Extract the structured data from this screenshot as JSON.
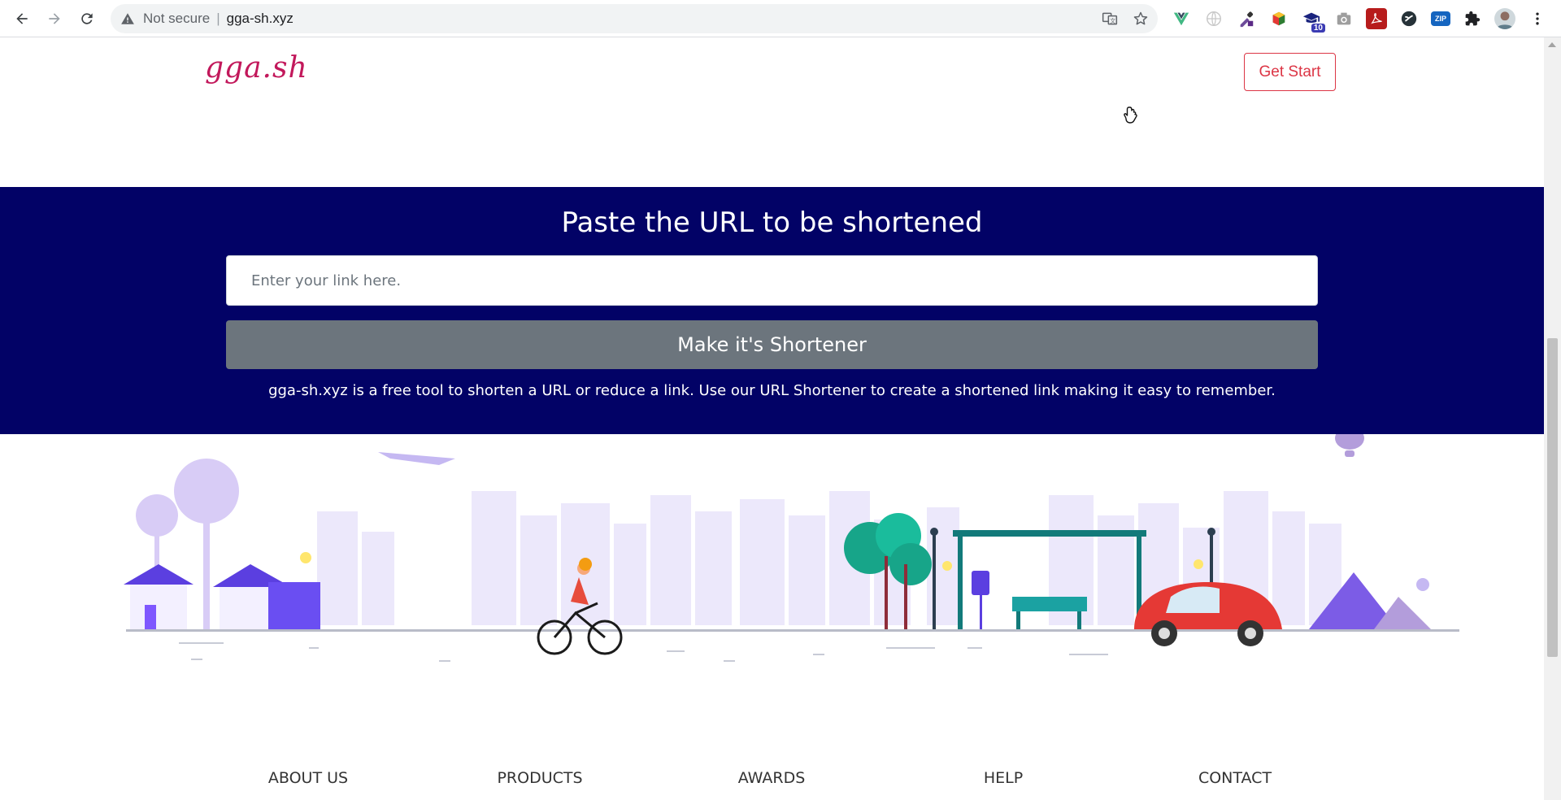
{
  "browser": {
    "security_label": "Not secure",
    "url": "gga-sh.xyz",
    "extensions": [
      {
        "name": "vue-devtools-icon"
      },
      {
        "name": "globe-icon"
      },
      {
        "name": "eyedropper-icon"
      },
      {
        "name": "cube-icon"
      },
      {
        "name": "graduation-cap-icon",
        "badge": "10"
      },
      {
        "name": "camera-icon"
      },
      {
        "name": "pdf-icon"
      },
      {
        "name": "slash-circle-icon"
      },
      {
        "name": "zip-icon",
        "label": "ZIP"
      },
      {
        "name": "puzzle-icon"
      }
    ]
  },
  "header": {
    "logo": "gga.sh",
    "get_start_label": "Get Start"
  },
  "hero": {
    "title": "Paste the URL to be shortened",
    "input_placeholder": "Enter your link here.",
    "button_label": "Make it's Shortener",
    "description": "gga-sh.xyz is a free tool to shorten a URL or reduce a link. Use our URL Shortener to create a shortened link making it easy to remember."
  },
  "footer": {
    "links": [
      "ABOUT US",
      "PRODUCTS",
      "AWARDS",
      "HELP",
      "CONTACT"
    ]
  },
  "colors": {
    "hero_bg": "#020266",
    "logo": "#c2185b",
    "accent_red": "#dc3545",
    "button_gray": "#6c757d"
  }
}
